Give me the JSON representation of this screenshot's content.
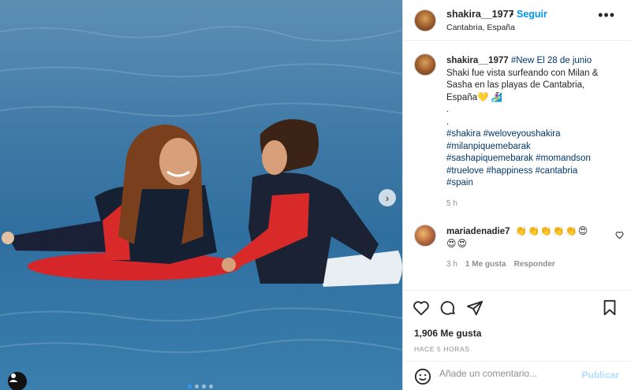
{
  "post": {
    "username": "shakira__1977",
    "follow_label": "Seguir",
    "location": "Cantabria, España",
    "more_label": "•••"
  },
  "caption": {
    "username": "shakira__1977",
    "line1": "#New El 28 de junio",
    "line2": "Shaki fue vista surfeando con Milan &",
    "line3": "Sasha en las playas de Cantabria,",
    "line4": "España💛 🏄‍♀️",
    "dot1": ".",
    "dot2": ".",
    "tags1": "#shakira #weloveyoushakira",
    "tags2": "#milanpiquemebarak",
    "tags3": "#sashapiquemebarak #momandson",
    "tags4": "#truelove #happiness #cantabria",
    "tags5": "#spain",
    "time": "5 h"
  },
  "comment": {
    "username": "mariadenadie7",
    "emoji_line1": "👏👏👏👏👏😍",
    "emoji_line2": "😍😍",
    "time": "3 h",
    "likes": "1 Me gusta",
    "reply": "Responder"
  },
  "actions": {
    "likes": "1,906 Me gusta",
    "posted_ago": "HACE 5 HORAS",
    "comment_placeholder": "Añade un comentario...",
    "publish_label": "Publicar"
  },
  "colors": {
    "accent": "#0095f6",
    "muted": "#8e8e8e",
    "publish_disabled": "#b2dffc"
  },
  "icons": [
    "more-icon",
    "heart-icon",
    "comment-icon",
    "share-icon",
    "bookmark-icon",
    "emoji-icon",
    "next-icon",
    "user-tag-icon"
  ]
}
